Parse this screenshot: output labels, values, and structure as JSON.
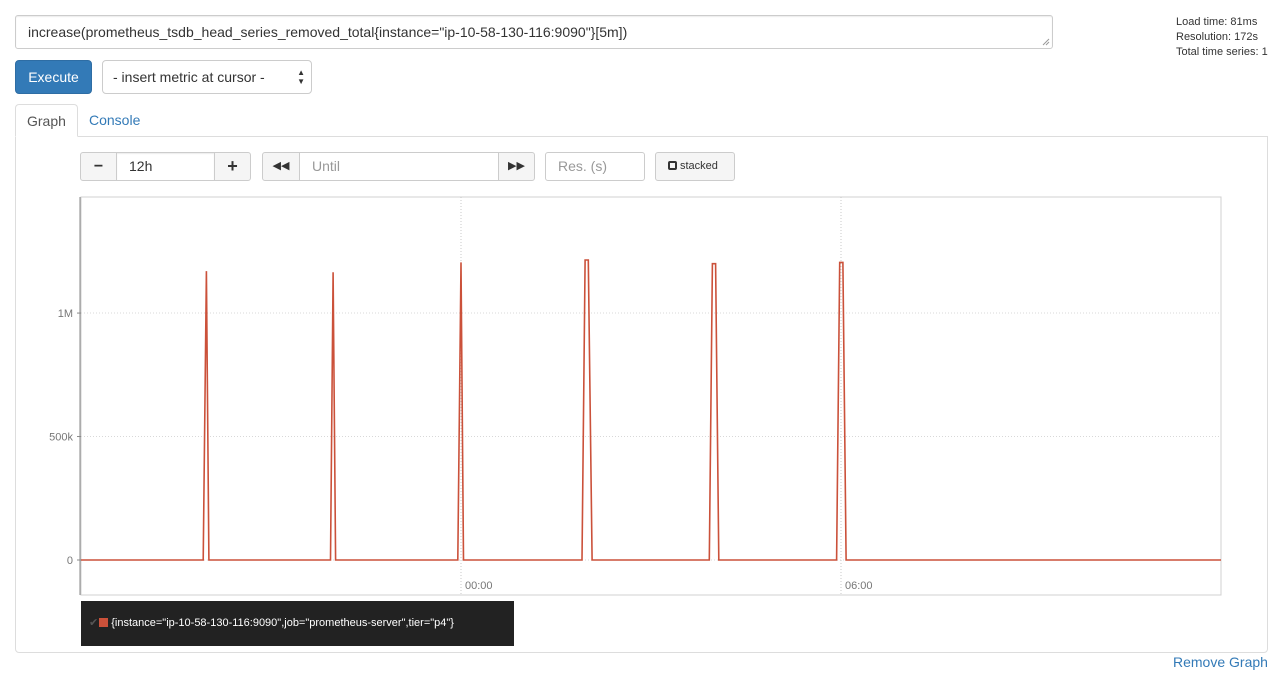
{
  "query": {
    "expression": "increase(prometheus_tsdb_head_series_removed_total{instance=\"ip-10-58-130-116:9090\"}[5m])"
  },
  "stats": {
    "load_time": "Load time: 81ms",
    "resolution": "Resolution: 172s",
    "total_series": "Total time series: 1"
  },
  "toolbar": {
    "execute_label": "Execute",
    "metric_select_value": "- insert metric at cursor -"
  },
  "tabs": [
    {
      "label": "Graph",
      "active": true
    },
    {
      "label": "Console",
      "active": false
    }
  ],
  "graph_controls": {
    "minus_label": "−",
    "range_value": "12h",
    "plus_label": "+",
    "back_label": "◀◀",
    "until_placeholder": "Until",
    "forward_label": "▶▶",
    "resolution_placeholder": "Res. (s)",
    "stacked_label": "stacked"
  },
  "chart_data": {
    "type": "line",
    "x_unit": "hours",
    "x_range": [
      -6.0,
      12.0
    ],
    "y_range": [
      0,
      1470000
    ],
    "y_ticks": [
      {
        "value": 0,
        "label": "0"
      },
      {
        "value": 500000,
        "label": "500k"
      },
      {
        "value": 1000000,
        "label": "1M"
      }
    ],
    "x_ticks": [
      {
        "value": 0,
        "label": "00:00"
      },
      {
        "value": 6,
        "label": "06:00"
      }
    ],
    "grid": true,
    "series": [
      {
        "name": "{instance=\"ip-10-58-130-116:9090\",job=\"prometheus-server\",tier=\"p4\"}",
        "color": "#cb513a",
        "points": [
          [
            -6.0,
            0
          ],
          [
            -4.07,
            0
          ],
          [
            -4.02,
            1170000
          ],
          [
            -3.98,
            0
          ],
          [
            -2.06,
            0
          ],
          [
            -2.02,
            1165000
          ],
          [
            -1.98,
            0
          ],
          [
            -0.05,
            0
          ],
          [
            0.0,
            1205000
          ],
          [
            0.04,
            0
          ],
          [
            1.91,
            0
          ],
          [
            1.96,
            1215000
          ],
          [
            2.01,
            1215000
          ],
          [
            2.07,
            0
          ],
          [
            3.92,
            0
          ],
          [
            3.97,
            1200000
          ],
          [
            4.02,
            1200000
          ],
          [
            4.07,
            0
          ],
          [
            5.93,
            0
          ],
          [
            5.98,
            1205000
          ],
          [
            6.03,
            1205000
          ],
          [
            6.08,
            0
          ],
          [
            12.0,
            0
          ]
        ]
      }
    ]
  },
  "legend": {
    "entries": [
      {
        "label": "{instance=\"ip-10-58-130-116:9090\",job=\"prometheus-server\",tier=\"p4\"}",
        "color": "#cb513a"
      }
    ]
  },
  "footer": {
    "remove_graph_label": "Remove Graph"
  }
}
